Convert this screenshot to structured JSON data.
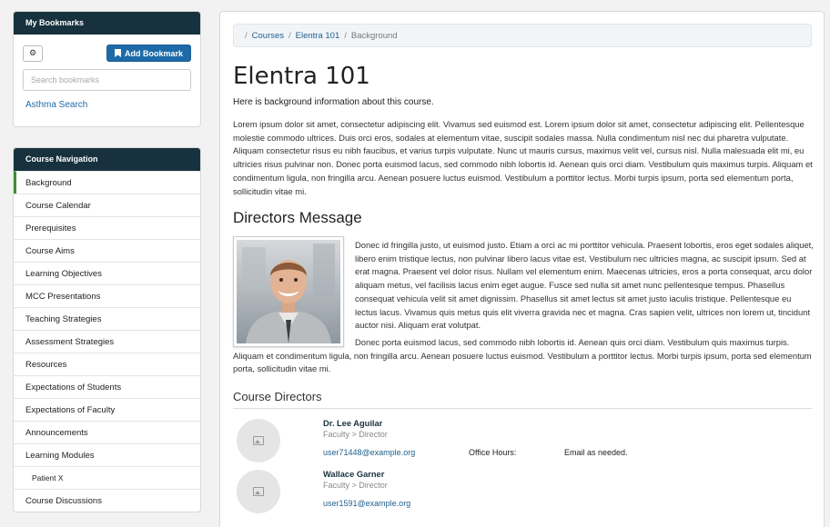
{
  "bookmarks": {
    "title": "My Bookmarks",
    "settings_icon": "gear-icon",
    "add_label": "Add Bookmark",
    "add_icon": "bookmark-icon",
    "search_placeholder": "Search bookmarks",
    "items": [
      "Asthma Search"
    ]
  },
  "course_nav": {
    "title": "Course Navigation",
    "items": [
      {
        "label": "Background",
        "active": true
      },
      {
        "label": "Course Calendar"
      },
      {
        "label": "Prerequisites"
      },
      {
        "label": "Course Aims"
      },
      {
        "label": "Learning Objectives"
      },
      {
        "label": "MCC Presentations"
      },
      {
        "label": "Teaching Strategies"
      },
      {
        "label": "Assessment Strategies"
      },
      {
        "label": "Resources"
      },
      {
        "label": "Expectations of Students"
      },
      {
        "label": "Expectations of Faculty"
      },
      {
        "label": "Announcements"
      },
      {
        "label": "Learning Modules"
      },
      {
        "label": "Patient X",
        "sub": true
      },
      {
        "label": "Course Discussions"
      }
    ]
  },
  "breadcrumb": [
    "Courses",
    "Elentra 101",
    "Background"
  ],
  "page": {
    "title": "Elentra 101",
    "intro": "Here is background information about this course.",
    "lorem": "Lorem ipsum dolor sit amet, consectetur adipiscing elit. Vivamus sed euismod est. Lorem ipsum dolor sit amet, consectetur adipiscing elit. Pellentesque molestie commodo ultrices. Duis orci eros, sodales at elementum vitae, suscipit sodales massa. Nulla condimentum nisl nec dui pharetra vulputate. Aliquam consectetur risus eu nibh faucibus, et varius turpis vulputate. Nunc ut mauris cursus, maximus velit vel, cursus nisl. Nulla malesuada elit mi, eu ultricies risus pulvinar non. Donec porta euismod lacus, sed commodo nibh lobortis id. Aenean quis orci diam. Vestibulum quis maximus turpis. Aliquam et condimentum ligula, non fringilla arcu. Aenean posuere luctus euismod. Vestibulum a porttitor lectus. Morbi turpis ipsum, porta sed elementum porta, sollicitudin vitae mi.",
    "directors_heading": "Directors Message",
    "directors_p1": "Donec id fringilla justo, ut euismod justo. Etiam a orci ac mi porttitor vehicula. Praesent lobortis, eros eget sodales aliquet, libero enim tristique lectus, non pulvinar libero lacus vitae est. Vestibulum nec ultricies magna, ac suscipit ipsum. Sed at erat magna. Praesent vel dolor risus. Nullam vel elementum enim. Maecenas ultricies, eros a porta consequat, arcu dolor aliquam metus, vel facilisis lacus enim eget augue. Fusce sed nulla sit amet nunc pellentesque tempus. Phasellus consequat vehicula velit sit amet dignissim. Phasellus sit amet lectus sit amet justo iaculis tristique. Pellentesque eu lectus lacus. Vivamus quis metus quis elit viverra gravida nec et magna. Cras sapien velit, ultrices non lorem ut, tincidunt auctor nisi. Aliquam erat volutpat.",
    "directors_p2": "Donec porta euismod lacus, sed commodo nibh lobortis id. Aenean quis orci diam. Vestibulum quis maximus turpis. Aliquam et condimentum ligula, non fringilla arcu. Aenean posuere luctus euismod. Vestibulum a porttitor lectus. Morbi turpis ipsum, porta sed elementum porta, sollicitudin vitae mi.",
    "course_directors_heading": "Course Directors"
  },
  "directors": [
    {
      "name": "Dr. Lee Aguilar",
      "role": "Faculty > Director",
      "email": "user71448@example.org",
      "office_hours_label": "Office Hours:",
      "office_hours": "Email as needed.",
      "avatar_icon": "image-placeholder-icon"
    },
    {
      "name": "Wallace Garner",
      "role": "Faculty > Director",
      "email": "user1591@example.org",
      "avatar_icon": "image-placeholder-icon"
    }
  ],
  "colors": {
    "header": "#17323e",
    "accent": "#1e6aa8",
    "active_marker": "#3d8f2f"
  }
}
